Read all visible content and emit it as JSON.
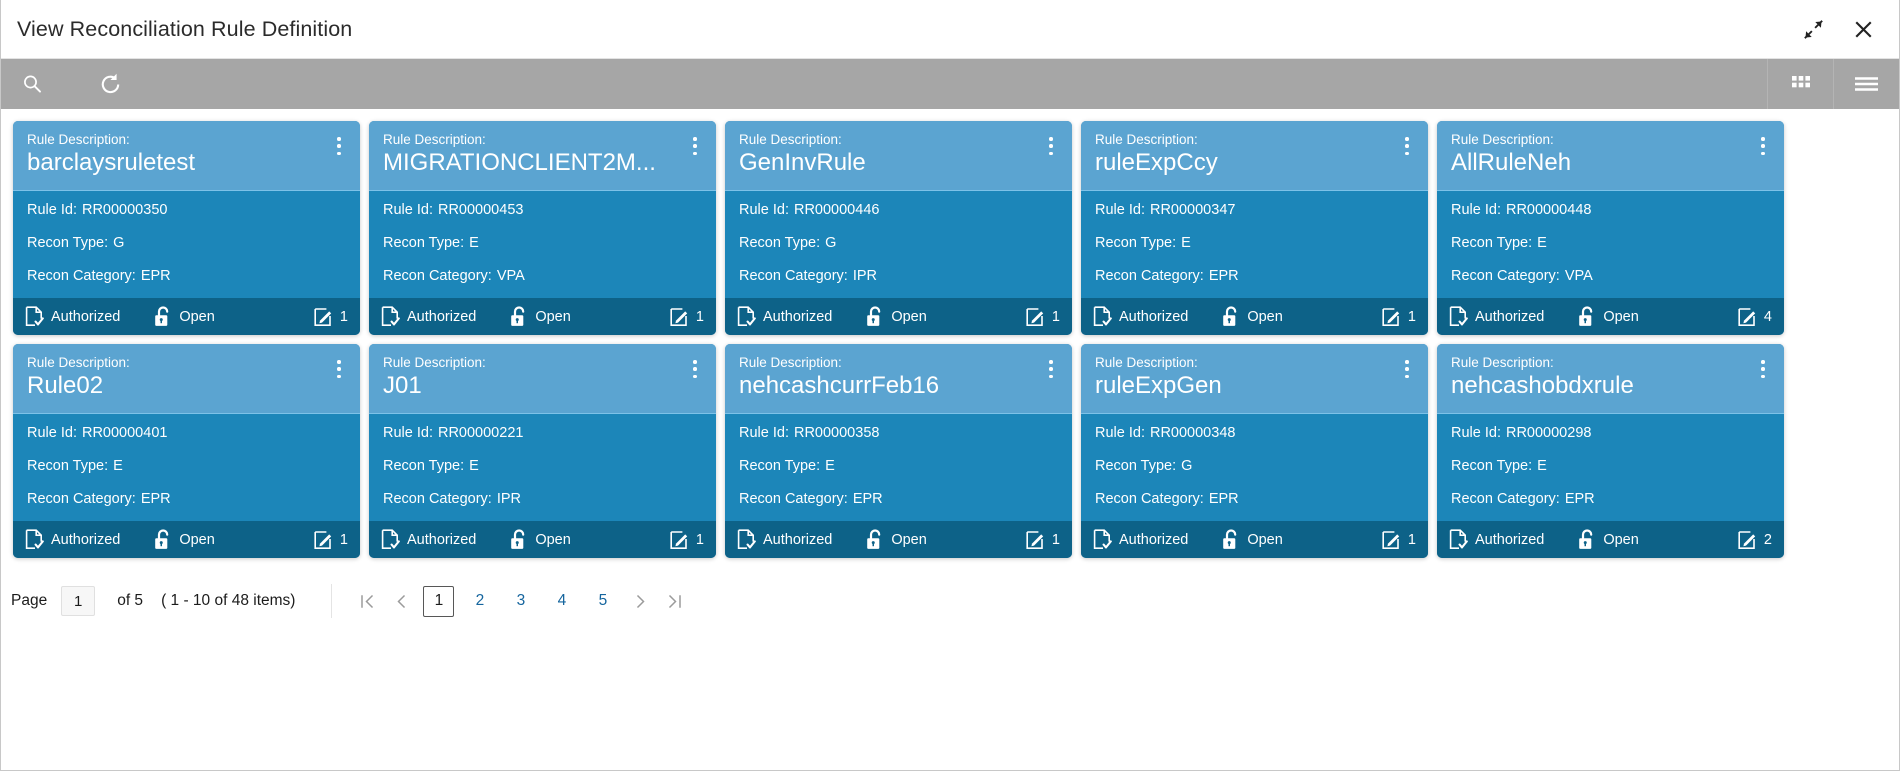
{
  "window": {
    "title": "View Reconciliation Rule Definition",
    "restore_icon": "restore-down-icon",
    "close_icon": "close-icon"
  },
  "toolbar": {
    "search_icon": "search-icon",
    "refresh_icon": "refresh-icon",
    "grid_view_icon": "grid-view-icon",
    "menu_icon": "hamburger-menu-icon"
  },
  "labels": {
    "rule_description": "Rule Description:",
    "rule_id": "Rule Id:",
    "recon_type": "Recon Type:",
    "recon_category": "Recon Category:"
  },
  "colors": {
    "card_header": "#5ba4d1",
    "card_body": "#1c86b9",
    "card_footer": "#0d6288",
    "toolbar": "#a6a6a6",
    "link": "#15659e"
  },
  "cards": [
    {
      "title": "barclaysruletest",
      "rule_id": "RR00000350",
      "recon_type": "G",
      "recon_category": "EPR",
      "status": "Authorized",
      "lock_state": "Open",
      "edit_count": "1"
    },
    {
      "title": "MIGRATIONCLIENT2M...",
      "rule_id": "RR00000453",
      "recon_type": "E",
      "recon_category": "VPA",
      "status": "Authorized",
      "lock_state": "Open",
      "edit_count": "1"
    },
    {
      "title": "GenInvRule",
      "rule_id": "RR00000446",
      "recon_type": "G",
      "recon_category": "IPR",
      "status": "Authorized",
      "lock_state": "Open",
      "edit_count": "1"
    },
    {
      "title": "ruleExpCcy",
      "rule_id": "RR00000347",
      "recon_type": "E",
      "recon_category": "EPR",
      "status": "Authorized",
      "lock_state": "Open",
      "edit_count": "1"
    },
    {
      "title": "AllRuleNeh",
      "rule_id": "RR00000448",
      "recon_type": "E",
      "recon_category": "VPA",
      "status": "Authorized",
      "lock_state": "Open",
      "edit_count": "4"
    },
    {
      "title": "Rule02",
      "rule_id": "RR00000401",
      "recon_type": "E",
      "recon_category": "EPR",
      "status": "Authorized",
      "lock_state": "Open",
      "edit_count": "1"
    },
    {
      "title": "J01",
      "rule_id": "RR00000221",
      "recon_type": "E",
      "recon_category": "IPR",
      "status": "Authorized",
      "lock_state": "Open",
      "edit_count": "1"
    },
    {
      "title": "nehcashcurrFeb16",
      "rule_id": "RR00000358",
      "recon_type": "E",
      "recon_category": "EPR",
      "status": "Authorized",
      "lock_state": "Open",
      "edit_count": "1"
    },
    {
      "title": "ruleExpGen",
      "rule_id": "RR00000348",
      "recon_type": "G",
      "recon_category": "EPR",
      "status": "Authorized",
      "lock_state": "Open",
      "edit_count": "1"
    },
    {
      "title": "nehcashobdxrule",
      "rule_id": "RR00000298",
      "recon_type": "E",
      "recon_category": "EPR",
      "status": "Authorized",
      "lock_state": "Open",
      "edit_count": "2"
    }
  ],
  "pagination": {
    "page_label": "Page",
    "page_value": "1",
    "of_text": "of 5",
    "range_text": "( 1 - 10 of 48 items)",
    "first_icon": "first-page-icon",
    "prev_icon": "previous-page-icon",
    "next_icon": "next-page-icon",
    "last_icon": "last-page-icon",
    "pages": [
      "1",
      "2",
      "3",
      "4",
      "5"
    ],
    "active_page": "1"
  }
}
